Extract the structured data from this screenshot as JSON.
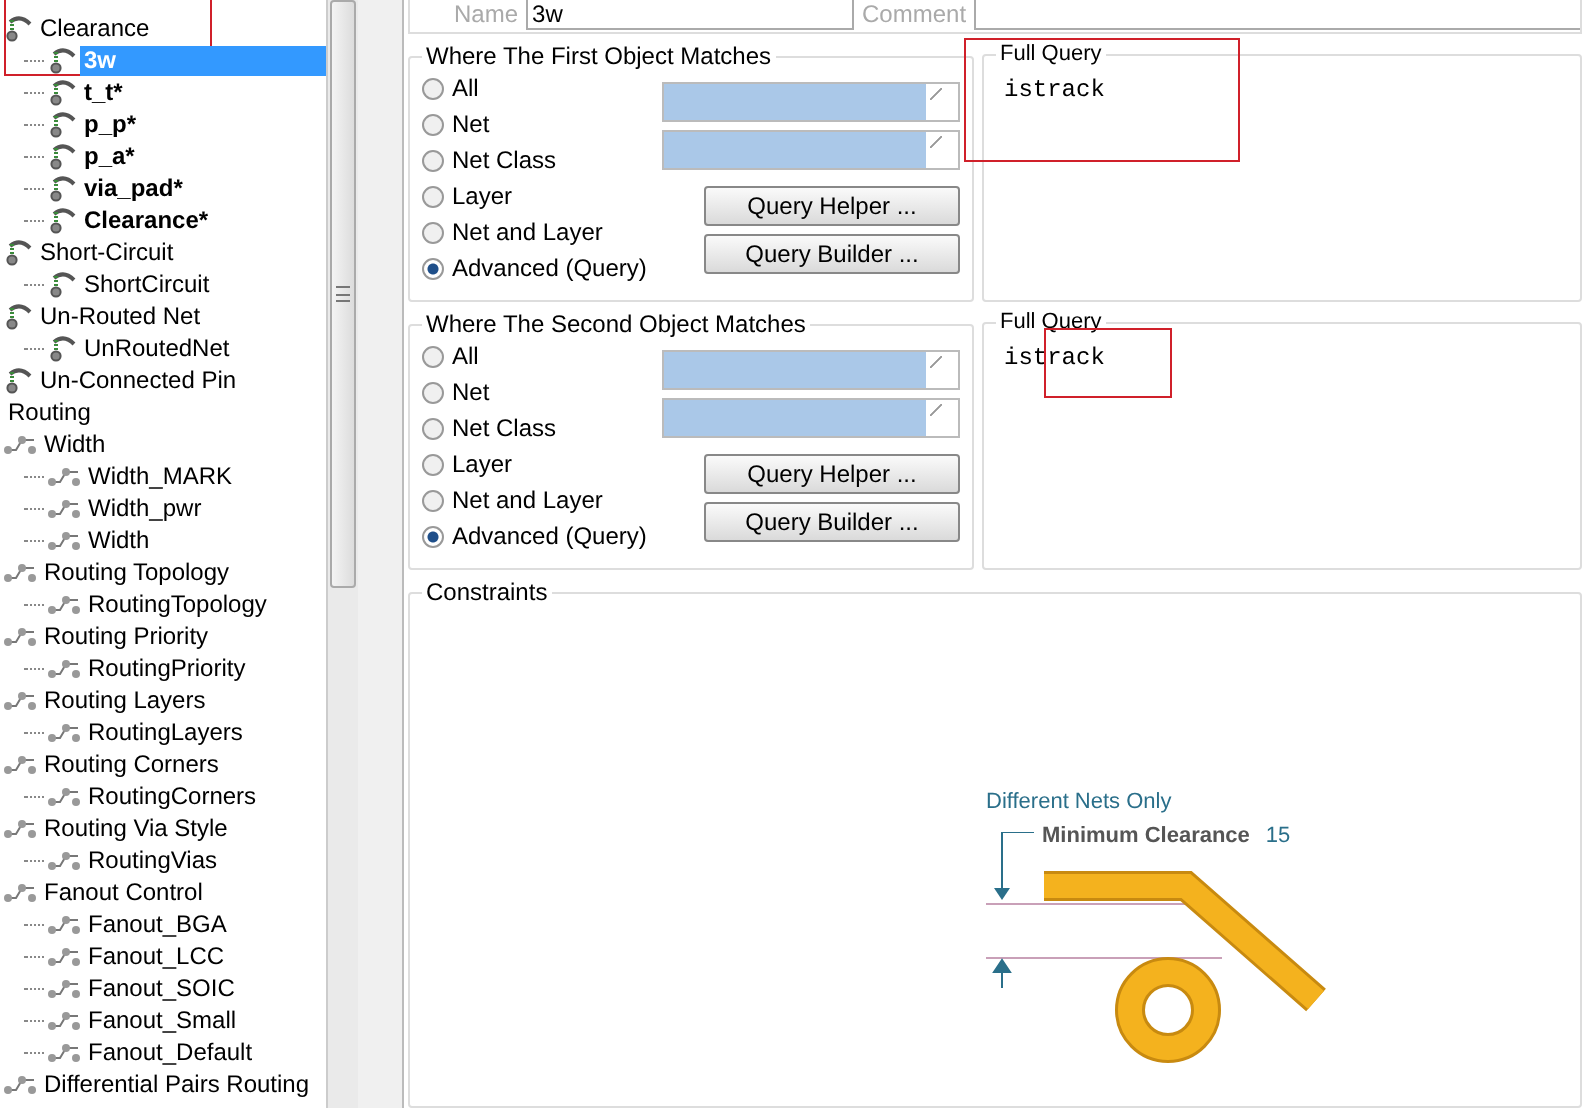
{
  "tree": [
    {
      "label": "Clearance",
      "kind": "electrical",
      "selected": false,
      "bold": false,
      "annotated": true,
      "children": [
        {
          "label": "3w",
          "kind": "electrical",
          "selected": true,
          "bold": true,
          "annotated": false
        },
        {
          "label": "t_t*",
          "kind": "electrical",
          "selected": false,
          "bold": true,
          "annotated": false
        },
        {
          "label": "p_p*",
          "kind": "electrical",
          "selected": false,
          "bold": true,
          "annotated": false
        },
        {
          "label": "p_a*",
          "kind": "electrical",
          "selected": false,
          "bold": true,
          "annotated": false
        },
        {
          "label": "via_pad*",
          "kind": "electrical",
          "selected": false,
          "bold": true,
          "annotated": false
        },
        {
          "label": "Clearance*",
          "kind": "electrical",
          "selected": false,
          "bold": true,
          "annotated": false
        }
      ]
    },
    {
      "label": "Short-Circuit",
      "kind": "electrical",
      "selected": false,
      "bold": false,
      "annotated": false,
      "children": [
        {
          "label": "ShortCircuit",
          "kind": "electrical",
          "selected": false,
          "bold": false,
          "annotated": false
        }
      ]
    },
    {
      "label": "Un-Routed Net",
      "kind": "electrical",
      "selected": false,
      "bold": false,
      "annotated": false,
      "children": [
        {
          "label": "UnRoutedNet",
          "kind": "electrical",
          "selected": false,
          "bold": false,
          "annotated": false
        }
      ]
    },
    {
      "label": "Un-Connected Pin",
      "kind": "electrical",
      "selected": false,
      "bold": false,
      "annotated": false
    },
    {
      "label": "Routing",
      "kind": "category",
      "selected": false,
      "bold": false,
      "annotated": false
    },
    {
      "label": "Width",
      "kind": "routing",
      "selected": false,
      "bold": false,
      "annotated": false,
      "children": [
        {
          "label": "Width_MARK",
          "kind": "routing",
          "selected": false,
          "bold": false,
          "annotated": false
        },
        {
          "label": "Width_pwr",
          "kind": "routing",
          "selected": false,
          "bold": false,
          "annotated": false
        },
        {
          "label": "Width",
          "kind": "routing",
          "selected": false,
          "bold": false,
          "annotated": false
        }
      ]
    },
    {
      "label": "Routing Topology",
      "kind": "routing",
      "selected": false,
      "bold": false,
      "annotated": false,
      "children": [
        {
          "label": "RoutingTopology",
          "kind": "routing",
          "selected": false,
          "bold": false,
          "annotated": false
        }
      ]
    },
    {
      "label": "Routing Priority",
      "kind": "routing",
      "selected": false,
      "bold": false,
      "annotated": false,
      "children": [
        {
          "label": "RoutingPriority",
          "kind": "routing",
          "selected": false,
          "bold": false,
          "annotated": false
        }
      ]
    },
    {
      "label": "Routing Layers",
      "kind": "routing",
      "selected": false,
      "bold": false,
      "annotated": false,
      "children": [
        {
          "label": "RoutingLayers",
          "kind": "routing",
          "selected": false,
          "bold": false,
          "annotated": false
        }
      ]
    },
    {
      "label": "Routing Corners",
      "kind": "routing",
      "selected": false,
      "bold": false,
      "annotated": false,
      "children": [
        {
          "label": "RoutingCorners",
          "kind": "routing",
          "selected": false,
          "bold": false,
          "annotated": false
        }
      ]
    },
    {
      "label": "Routing Via Style",
      "kind": "routing",
      "selected": false,
      "bold": false,
      "annotated": false,
      "children": [
        {
          "label": "RoutingVias",
          "kind": "routing",
          "selected": false,
          "bold": false,
          "annotated": false
        }
      ]
    },
    {
      "label": "Fanout Control",
      "kind": "routing",
      "selected": false,
      "bold": false,
      "annotated": false,
      "children": [
        {
          "label": "Fanout_BGA",
          "kind": "routing",
          "selected": false,
          "bold": false,
          "annotated": false
        },
        {
          "label": "Fanout_LCC",
          "kind": "routing",
          "selected": false,
          "bold": false,
          "annotated": false
        },
        {
          "label": "Fanout_SOIC",
          "kind": "routing",
          "selected": false,
          "bold": false,
          "annotated": false
        },
        {
          "label": "Fanout_Small",
          "kind": "routing",
          "selected": false,
          "bold": false,
          "annotated": false
        },
        {
          "label": "Fanout_Default",
          "kind": "routing",
          "selected": false,
          "bold": false,
          "annotated": false
        }
      ]
    },
    {
      "label": "Differential Pairs Routing",
      "kind": "routing",
      "selected": false,
      "bold": false,
      "annotated": false
    }
  ],
  "rule": {
    "name_label": "Name",
    "name": "3w",
    "comment_label": "Comment"
  },
  "matches": [
    {
      "title": "Where The First Object Matches",
      "options": [
        {
          "label": "All",
          "selected": false
        },
        {
          "label": "Net",
          "selected": false
        },
        {
          "label": "Net Class",
          "selected": false
        },
        {
          "label": "Layer",
          "selected": false
        },
        {
          "label": "Net and Layer",
          "selected": false
        },
        {
          "label": "Advanced (Query)",
          "selected": true
        }
      ],
      "buttons": [
        "Query Helper ...",
        "Query Builder ..."
      ],
      "query_title": "Full Query",
      "query": "istrack",
      "annotated": true
    },
    {
      "title": "Where The Second Object Matches",
      "options": [
        {
          "label": "All",
          "selected": false
        },
        {
          "label": "Net",
          "selected": false
        },
        {
          "label": "Net Class",
          "selected": false
        },
        {
          "label": "Layer",
          "selected": false
        },
        {
          "label": "Net and Layer",
          "selected": false
        },
        {
          "label": "Advanced (Query)",
          "selected": true
        }
      ],
      "buttons": [
        "Query Helper ...",
        "Query Builder ..."
      ],
      "query_title": "Full Query",
      "query": "istrack",
      "annotated": true
    }
  ],
  "constraints": {
    "title": "Constraints",
    "scope": "Different Nets Only",
    "clearance_label": "Minimum Clearance",
    "clearance_value": "15"
  }
}
